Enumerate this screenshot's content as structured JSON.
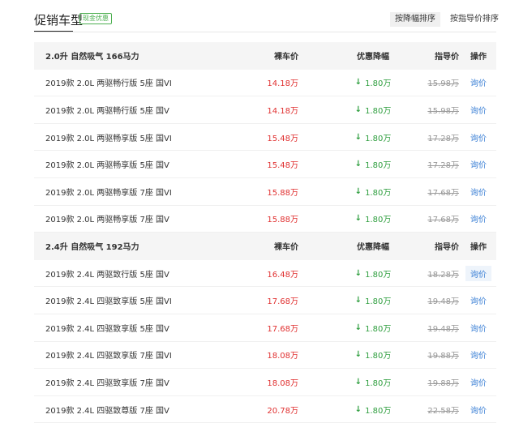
{
  "header": {
    "title": "促销车型",
    "badge": "现金优惠",
    "sort_discount": "按降幅排序",
    "sort_guide": "按指导价排序"
  },
  "columns": {
    "price": "裸车价",
    "discount": "优惠降幅",
    "guide": "指导价",
    "op": "操作"
  },
  "groups": [
    {
      "label": "2.0升 自然吸气 166马力",
      "rows": [
        {
          "name": "2019款 2.0L 两驱畅行版 5座 国VI",
          "price": "14.18万",
          "discount": "1.80万",
          "guide": "15.98万",
          "op": "询价"
        },
        {
          "name": "2019款 2.0L 两驱畅行版 5座 国V",
          "price": "14.18万",
          "discount": "1.80万",
          "guide": "15.98万",
          "op": "询价"
        },
        {
          "name": "2019款 2.0L 两驱畅享版 5座 国VI",
          "price": "15.48万",
          "discount": "1.80万",
          "guide": "17.28万",
          "op": "询价"
        },
        {
          "name": "2019款 2.0L 两驱畅享版 5座 国V",
          "price": "15.48万",
          "discount": "1.80万",
          "guide": "17.28万",
          "op": "询价"
        },
        {
          "name": "2019款 2.0L 两驱畅享版 7座 国VI",
          "price": "15.88万",
          "discount": "1.80万",
          "guide": "17.68万",
          "op": "询价"
        },
        {
          "name": "2019款 2.0L 两驱畅享版 7座 国V",
          "price": "15.88万",
          "discount": "1.80万",
          "guide": "17.68万",
          "op": "询价"
        }
      ]
    },
    {
      "label": "2.4升 自然吸气 192马力",
      "rows": [
        {
          "name": "2019款 2.4L 两驱致行版 5座 国V",
          "price": "16.48万",
          "discount": "1.80万",
          "guide": "18.28万",
          "op": "询价"
        },
        {
          "name": "2019款 2.4L 四驱致享版 5座 国VI",
          "price": "17.68万",
          "discount": "1.80万",
          "guide": "19.48万",
          "op": "询价"
        },
        {
          "name": "2019款 2.4L 四驱致享版 5座 国V",
          "price": "17.68万",
          "discount": "1.80万",
          "guide": "19.48万",
          "op": "询价"
        },
        {
          "name": "2019款 2.4L 四驱致享版 7座 国VI",
          "price": "18.08万",
          "discount": "1.80万",
          "guide": "19.88万",
          "op": "询价"
        },
        {
          "name": "2019款 2.4L 四驱致享版 7座 国V",
          "price": "18.08万",
          "discount": "1.80万",
          "guide": "19.88万",
          "op": "询价"
        },
        {
          "name": "2019款 2.4L 四驱致尊版 7座 国V",
          "price": "20.78万",
          "discount": "1.80万",
          "guide": "22.58万",
          "op": "询价"
        }
      ]
    }
  ],
  "icons": {
    "discount_arrow": "down-arrow-icon"
  },
  "colors": {
    "price": "#e03030",
    "discount": "#2e9e3e",
    "link": "#3a7fd5",
    "badge": "#4caf50"
  }
}
